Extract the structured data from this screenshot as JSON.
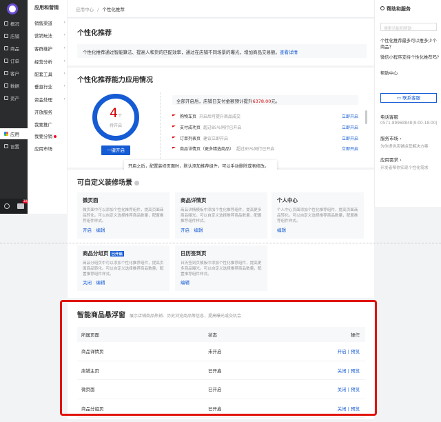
{
  "rail": {
    "items": [
      {
        "label": "概况"
      },
      {
        "label": "店铺"
      },
      {
        "label": "商品"
      },
      {
        "label": "订单"
      },
      {
        "label": "客户"
      },
      {
        "label": "数据"
      },
      {
        "label": "资产"
      },
      {
        "label": "应用"
      },
      {
        "label": "设置"
      }
    ],
    "tools": {
      "badge": "32"
    }
  },
  "nav2": {
    "title": "应用和营销",
    "items": [
      {
        "label": "销售渠道"
      },
      {
        "label": "营销玩法"
      },
      {
        "label": "客群维护"
      },
      {
        "label": "经营分析"
      },
      {
        "label": "配套工具"
      },
      {
        "label": "垂直行业"
      },
      {
        "label": "资金处理"
      },
      {
        "label": "开放服务"
      },
      {
        "label": "我要推广"
      },
      {
        "label": "我要分销"
      },
      {
        "label": "应用市场"
      }
    ]
  },
  "breadcrumb": {
    "parent": "应用中心",
    "sep": "/",
    "current": "个性化推荐"
  },
  "intro": {
    "title": "个性化推荐",
    "desc": "个性化推荐通过智能算法、提高人和货的匹配效率，通过在店铺不同场景的曝光，增加商品交易额。",
    "link": "查看详情"
  },
  "ability": {
    "title": "个性化推荐能力应用情况",
    "count": "4",
    "unit": "个",
    "count_label": "待开启",
    "open_btn": "一键开启",
    "summary_pre": "全部开启后，店铺日支付金额预计提升",
    "summary_amt": "6378.00",
    "summary_post": "元。",
    "rows": [
      {
        "name": "购物车页",
        "desc": "开启后可提升商品成交",
        "action": "立即开启"
      },
      {
        "name": "支付成功页",
        "desc": "超过85%同行已开启",
        "action": "立即开启"
      },
      {
        "name": "订单列表页",
        "desc": "建议立即开启",
        "action": "立即开启"
      },
      {
        "name": "商品详情页（更多精选商品）",
        "desc": "超过85%同行已开启",
        "action": "立即开启"
      }
    ],
    "tooltip": "开启之后，配置装修页面时，默认添加推荐组件，可以手动删除或者修改。"
  },
  "scenes": {
    "title": "可自定义装修场景",
    "items": [
      {
        "title": "微页面",
        "desc": "微页面中可以添加个性化推荐组件，提高页面商品转化。可以自定义选择推荐商品数量，配置推荐组件样式。",
        "op1": "开启",
        "sep": "|",
        "op2": "编辑"
      },
      {
        "title": "商品详情页",
        "desc": "商品详情模板中添加个性化推荐组件，提高更多商品曝光。可以自定义选择推荐商品数量，配置推荐组件样式。",
        "op1": "开启",
        "sep": "|",
        "op2": "编辑"
      },
      {
        "title": "个人中心",
        "desc": "个人中心页面添加个性化推荐组件，提高页面商品转化。可以自定义选择推荐商品数量，配置推荐组件样式。",
        "op2": "编辑"
      },
      {
        "title": "商品分组页",
        "badge": "已开启",
        "desc": "商品分组页中可以添加个性化推荐组件，提高页面商品转化。可以自定义选择推荐商品数量，配置推荐组件样式。",
        "op1": "关闭",
        "sep": "|",
        "op2": "编辑"
      },
      {
        "title": "日历签到页",
        "desc": "日历签到页模板中添加个性化推荐组件，提高更多商品曝光。可以自定义选择推荐商品数量，配置推荐组件样式。",
        "op2": "编辑"
      }
    ]
  },
  "float": {
    "title": "智能商品悬浮窗",
    "subtitle": "展示店铺商品热销、历史浏览商品等信息，提高曝光或交机会",
    "headers": [
      "所属页面",
      "状态",
      "操作"
    ],
    "rows": [
      {
        "page": "商品详情页",
        "status": "未开启",
        "op1": "开启",
        "sep": "|",
        "op2": "预览"
      },
      {
        "page": "店铺主页",
        "status": "已开启",
        "op1": "关闭",
        "sep": "|",
        "op2": "预览"
      },
      {
        "page": "微页面",
        "status": "已开启",
        "op1": "关闭",
        "sep": "|",
        "op2": "预览"
      },
      {
        "page": "商品分组页",
        "status": "已开启",
        "op1": "关闭",
        "sep": "|",
        "op2": "预览"
      }
    ]
  },
  "help": {
    "title": "帮助和服务",
    "search_placeholder": "搜索功能和帮助",
    "q1": "个性化推荐最多可以推多少个商品？",
    "q2": "微信小程序支持个性化推荐吗?",
    "center": "帮助中心",
    "contact": "联系客服",
    "phone_title": "电话客服",
    "phone": "0571-89968848(9:00-18:00)",
    "market": "服务市场",
    "market_sub": "为你提供店铺运营解决方案",
    "demand": "应用需求",
    "demand_sub": "开发者帮你实现个性化需求"
  }
}
